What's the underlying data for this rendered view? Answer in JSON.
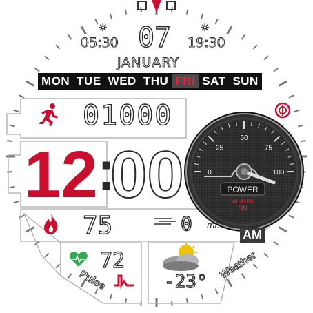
{
  "top": {
    "sunrise": "05:30",
    "date_day": "07",
    "sunset": "19:30",
    "month": "JANUARY"
  },
  "weekdays": {
    "items": [
      "MON",
      "TUE",
      "WED",
      "THU",
      "FRI",
      "SAT",
      "SUN"
    ],
    "active": "FRI"
  },
  "steps": {
    "value": "01000"
  },
  "time": {
    "hour": "12",
    "minute": "00",
    "ampm": "AM"
  },
  "gauge": {
    "ticks": [
      "0",
      "25",
      "50",
      "75",
      "100"
    ],
    "level": 100,
    "power_label": "POWER",
    "alarm_label": "ALARM\nON"
  },
  "calories": {
    "value": "75"
  },
  "wind": {
    "value": "0",
    "unit": "m/s"
  },
  "pulse": {
    "value": "72",
    "label": "Pulse"
  },
  "weather": {
    "temperature": "-23°",
    "label": "Weather"
  },
  "colors": {
    "accent": "#c8102e",
    "dark": "#2a2a2a",
    "panel": "#3a3a3a"
  }
}
